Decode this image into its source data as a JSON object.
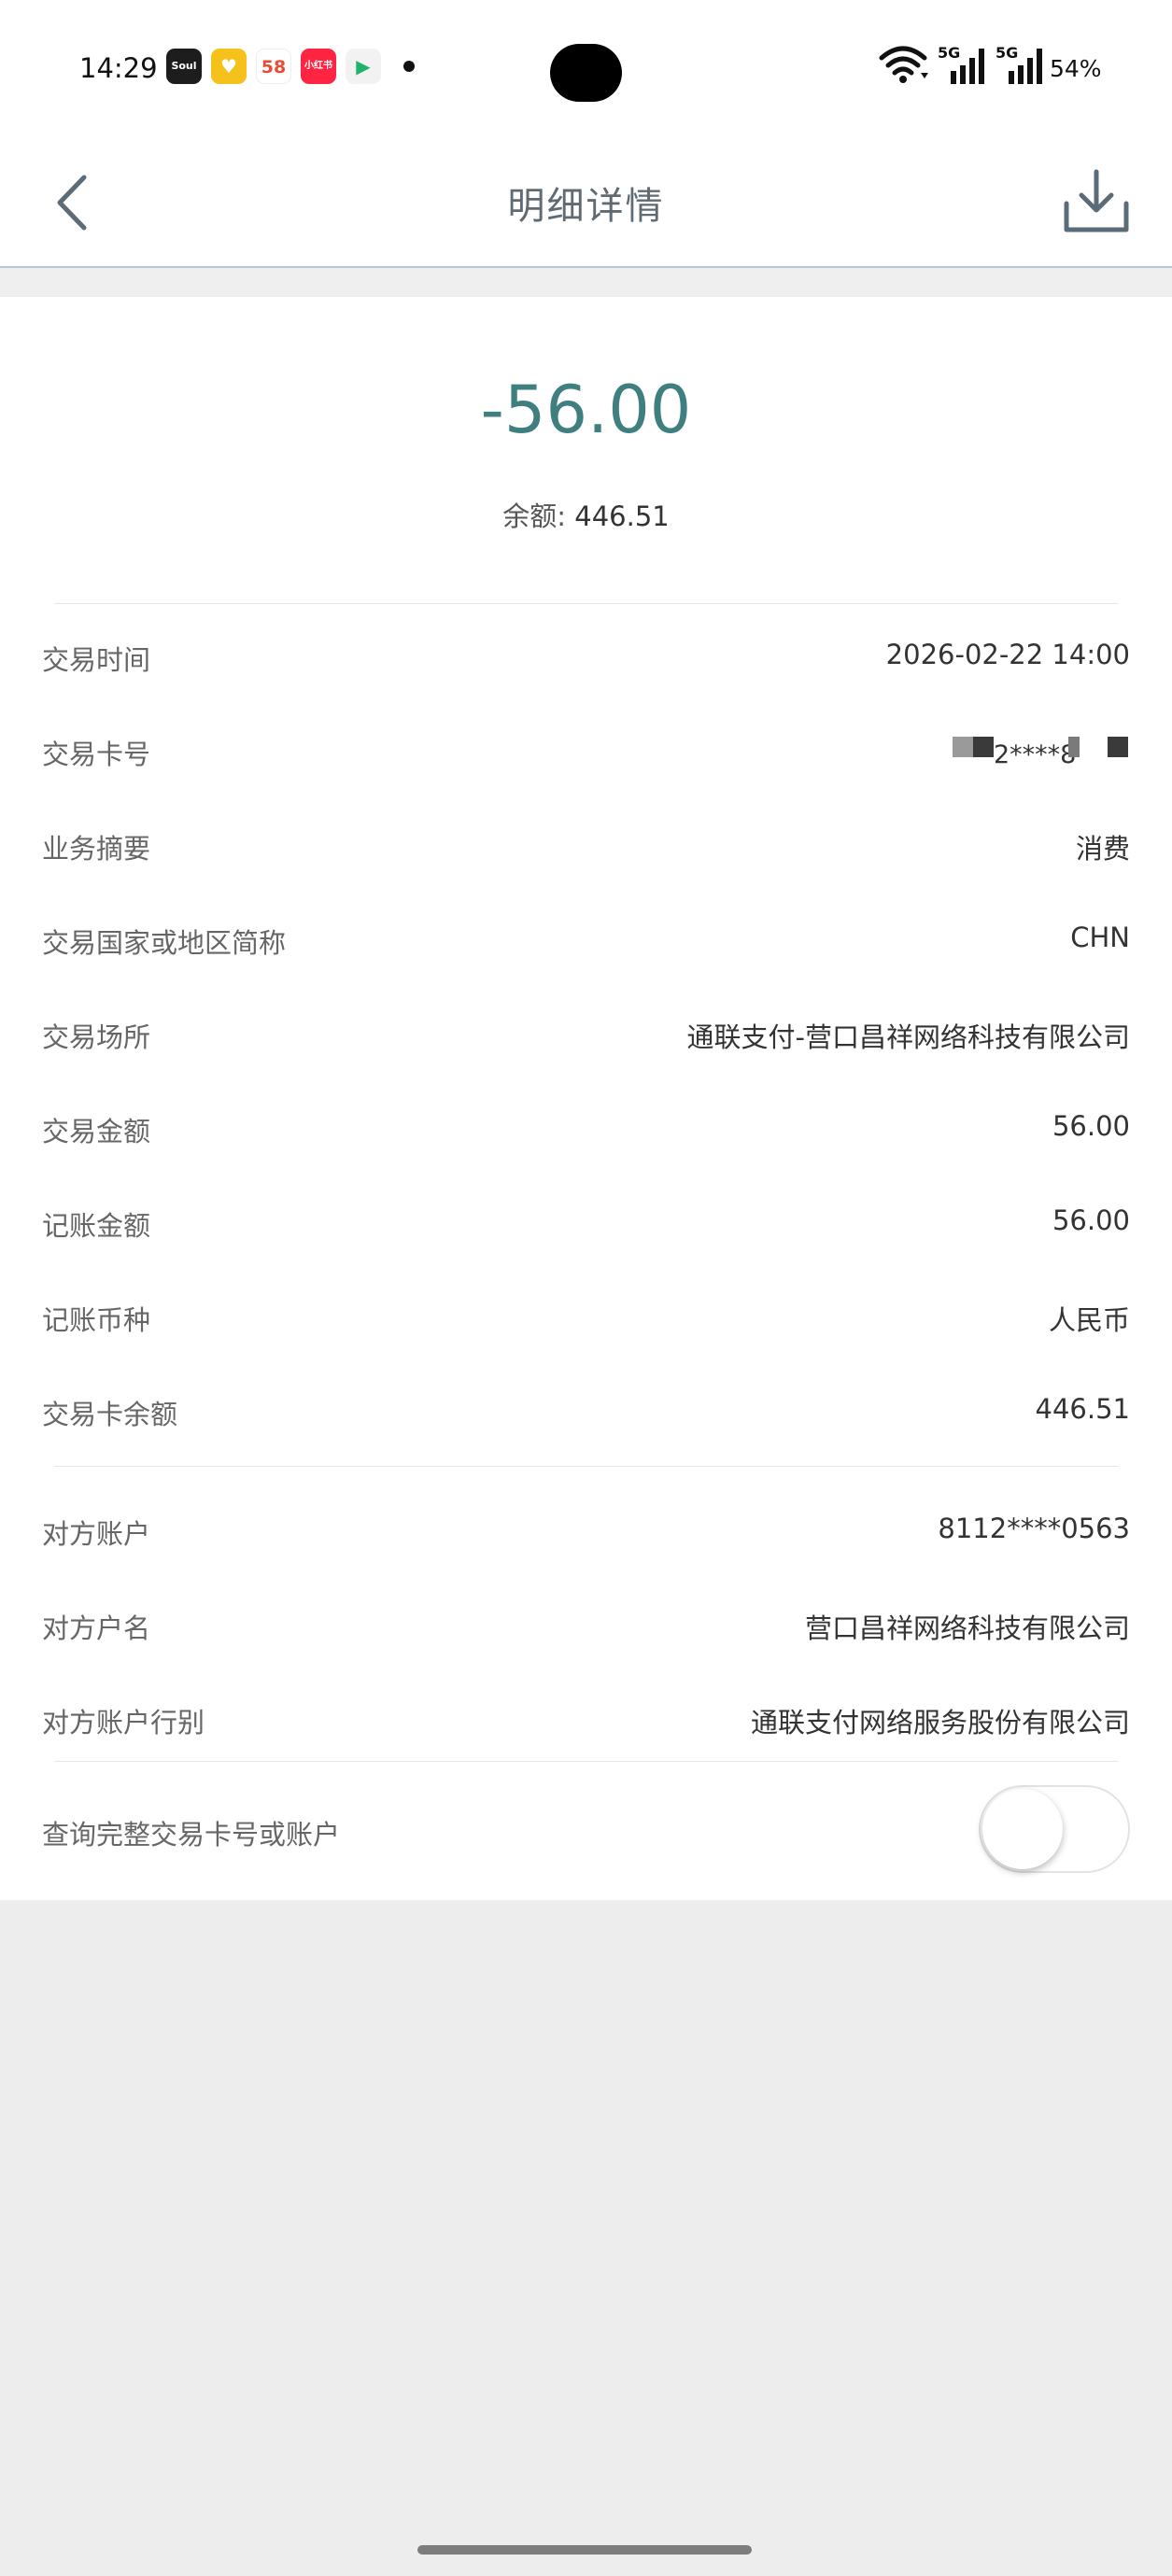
{
  "status_bar": {
    "time": "14:29",
    "battery": "54%",
    "network_1": "5G",
    "network_2": "5G",
    "notification_apps": [
      {
        "label": "Soul",
        "color": "#1d1d1d"
      },
      {
        "label": "♥",
        "color": "#f5c21b"
      },
      {
        "label": "58",
        "color": "#ffffff"
      },
      {
        "label": "小红书",
        "color": "#ff2442"
      },
      {
        "label": "▶",
        "color": "#f2f2f2"
      }
    ]
  },
  "nav": {
    "title": "明细详情",
    "back_icon": "chevron-left-icon",
    "download_icon": "download-icon"
  },
  "summary": {
    "amount": "-56.00",
    "balance_label": "余额:",
    "balance_value": "446.51"
  },
  "details": [
    {
      "label": "交易时间",
      "value": "2026-02-22  14:00"
    },
    {
      "label": "交易卡号",
      "value": "2****8"
    },
    {
      "label": "业务摘要",
      "value": "消费"
    },
    {
      "label": "交易国家或地区简称",
      "value": "CHN"
    },
    {
      "label": "交易场所",
      "value": "通联支付-营口昌祥网络科技有限公司"
    },
    {
      "label": "交易金额",
      "value": "56.00"
    },
    {
      "label": "记账金额",
      "value": "56.00"
    },
    {
      "label": "记账币种",
      "value": "人民币"
    },
    {
      "label": "交易卡余额",
      "value": "446.51"
    }
  ],
  "counterparty": [
    {
      "label": "对方账户",
      "value": "8112****0563"
    },
    {
      "label": "对方户名",
      "value": "营口昌祥网络科技有限公司"
    },
    {
      "label": "对方账户行别",
      "value": "通联支付网络服务股份有限公司"
    }
  ],
  "query": {
    "label": "查询完整交易卡号或账户",
    "toggle_on": false
  },
  "colors": {
    "amount": "#3f7f80",
    "nav_title": "#5f6a72",
    "background": "#ededed"
  }
}
